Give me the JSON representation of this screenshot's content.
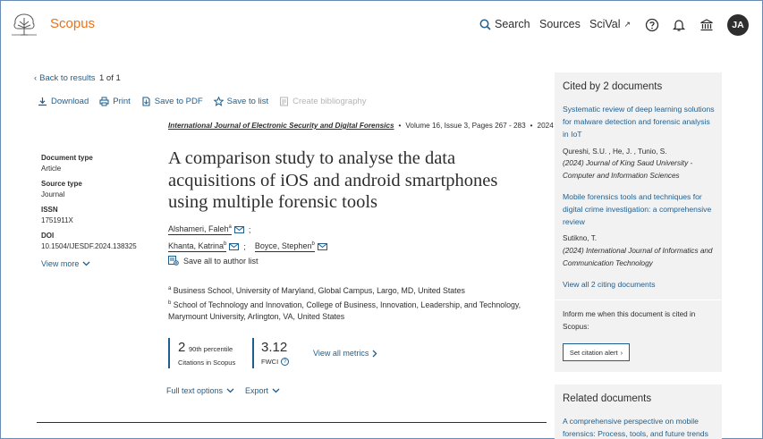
{
  "header": {
    "brand": "Scopus",
    "search_label": "Search",
    "sources_label": "Sources",
    "scival_label": "SciVal",
    "scival_ext_icon": "↗",
    "avatar_initials": "JA",
    "icons": [
      "search-icon",
      "help-icon",
      "bell-icon",
      "institution-icon"
    ]
  },
  "nav": {
    "back_label": "Back to results",
    "pager": "1 of 1"
  },
  "toolbar": {
    "download": "Download",
    "print": "Print",
    "save_pdf": "Save to PDF",
    "save_list": "Save to list",
    "create_bib": "Create bibliography"
  },
  "meta": {
    "doc_type_label": "Document type",
    "doc_type": "Article",
    "source_type_label": "Source type",
    "source_type": "Journal",
    "issn_label": "ISSN",
    "issn": "1751911X",
    "doi_label": "DOI",
    "doi": "10.1504/IJESDF.2024.138325",
    "view_more": "View more"
  },
  "article": {
    "journal": "International Journal of Electronic Security and Digital Forensics",
    "volume": "Volume 16, Issue 3, Pages 267 - 283",
    "year": "2024",
    "title": "A comparison study to analyse the data acquisitions of iOS and android smartphones using multiple forensic tools",
    "authors": [
      {
        "name": "Alshameri, Faleh",
        "sup": "a",
        "sep": ";"
      },
      {
        "name": "Khanta, Katrina",
        "sup": "b",
        "sep": ";"
      },
      {
        "name": "Boyce, Stephen",
        "sup": "b",
        "sep": ""
      }
    ],
    "save_all": "Save all to author list",
    "affiliations": [
      {
        "sup": "a",
        "text": "Business School, University of Maryland, Global Campus, Largo, MD, United States"
      },
      {
        "sup": "b",
        "text": "School of Technology and Innovation, College of Business, Innovation, Leadership, and Technology, Marymount University, Arlington, VA, United States"
      }
    ]
  },
  "metrics": {
    "citations": "2",
    "percentile": "90th percentile",
    "citations_label": "Citations in Scopus",
    "fwci": "3.12",
    "fwci_label": "FWCI",
    "view_all": "View all metrics"
  },
  "options": {
    "full_text": "Full text options",
    "export": "Export"
  },
  "cited": {
    "heading": "Cited by 2 documents",
    "items": [
      {
        "title": "Systematic review of deep learning solutions for malware detection and forensic analysis in IoT",
        "authors": "Qureshi, S.U. , He, J. , Tunio, S.",
        "source": "(2024) Journal of King Saud University - Computer and Information Sciences"
      },
      {
        "title": "Mobile forensics tools and techniques for digital crime investigation: a comprehensive review",
        "authors": "Sutikno, T.",
        "source": "(2024) International Journal of Informatics and Communication Technology"
      }
    ],
    "view_all": "View all 2 citing documents",
    "inform": "Inform me when this document is cited in Scopus:",
    "alert_button": "Set citation alert"
  },
  "related": {
    "heading": "Related documents",
    "first_item": "A comprehensive perspective on mobile forensics: Process, tools, and future trends"
  },
  "colors": {
    "brand": "#e9711c",
    "link": "#1f5f8f",
    "panel_bg": "#f2f2f2",
    "text": "#2e2e2e"
  }
}
